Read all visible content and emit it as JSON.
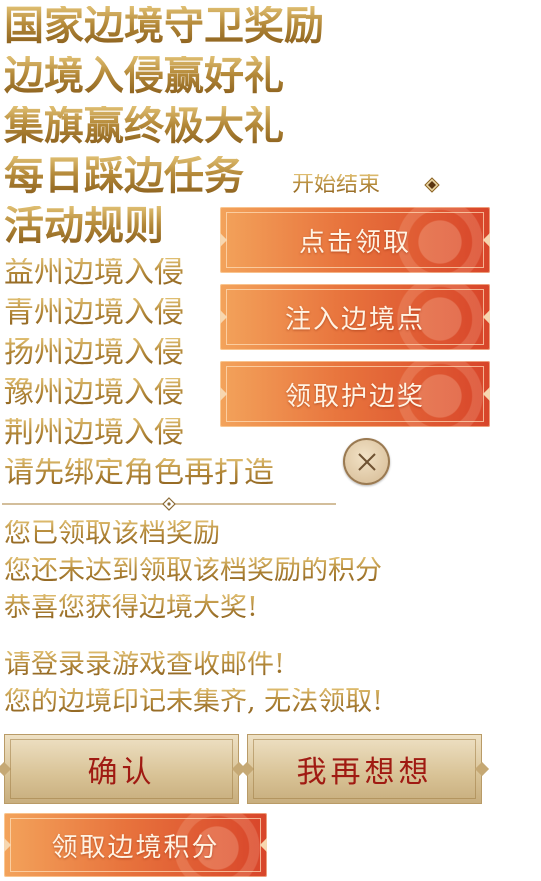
{
  "titles": {
    "line1": "国家边境守卫奖励",
    "line2": "边境入侵赢好礼",
    "line3": "集旗赢终极大礼",
    "line4": "每日踩边任务",
    "start_end": "开始结束",
    "rules": "活动规则"
  },
  "regions": [
    "益州边境入侵",
    "青州边境入侵",
    "扬州边境入侵",
    "豫州边境入侵",
    "荆州边境入侵"
  ],
  "bind_role": "请先绑定角色再打造",
  "buttons": {
    "claim": "点击领取",
    "inject": "注入边境点",
    "claim_guard": "领取护边奖",
    "confirm": "确认",
    "think_again": "我再想想",
    "claim_points": "领取边境积分"
  },
  "messages": {
    "claimed": "您已领取该档奖励",
    "not_enough": "您还未达到领取该档奖励的积分",
    "congrats": "恭喜您获得边境大奖!",
    "check_mail": "请登录录游戏查收邮件!",
    "incomplete": "您的边境印记未集齐, 无法领取!"
  },
  "colors": {
    "gold_text": "#b58a3a",
    "button_red": "#e0572f",
    "button_orange": "#f3a35b",
    "confirm_text": "#a01a12"
  },
  "icons": {
    "close": "close-icon",
    "diamond": "diamond-icon"
  }
}
